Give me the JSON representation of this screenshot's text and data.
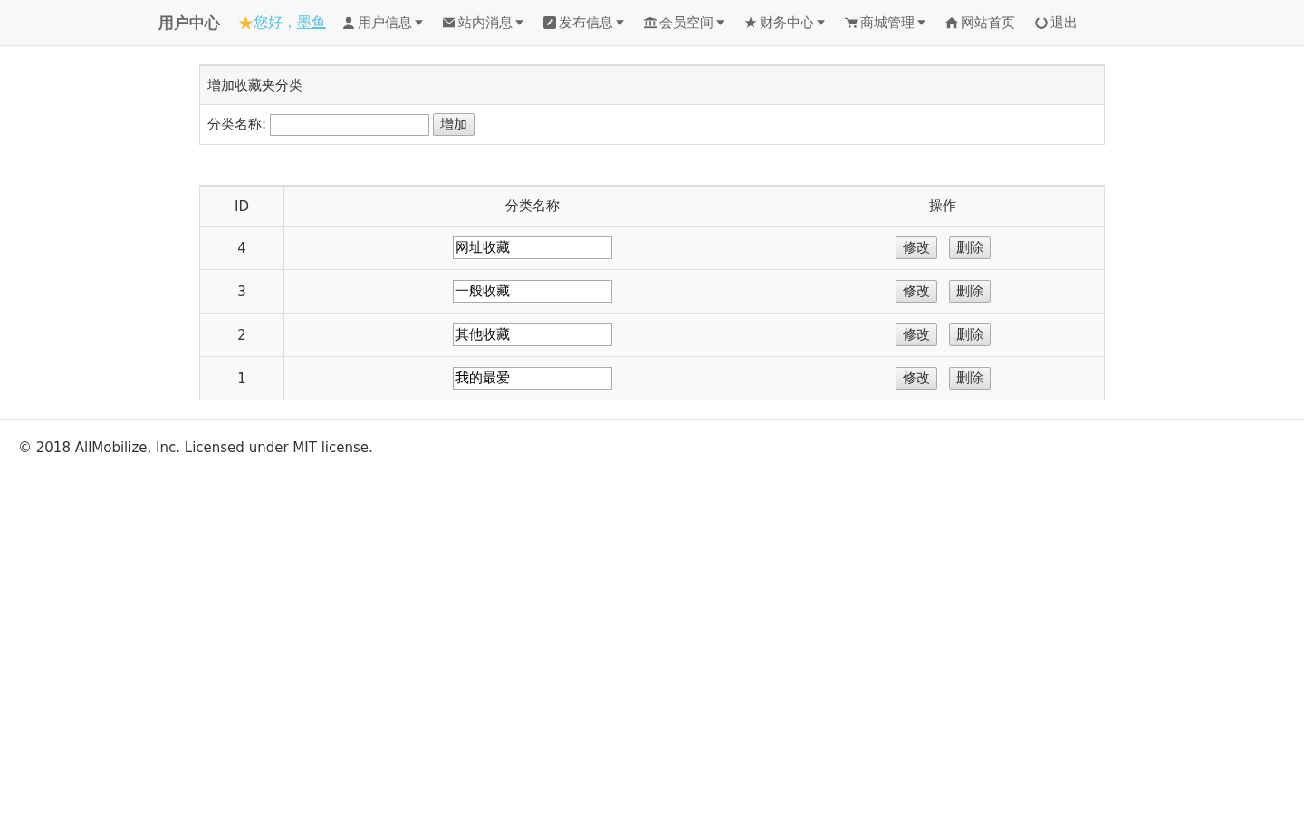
{
  "navbar": {
    "brand": "用户中心",
    "greeting": "您好，",
    "username": "墨鱼",
    "items": [
      {
        "label": "用户信息",
        "dropdown": true
      },
      {
        "label": "站内消息",
        "dropdown": true
      },
      {
        "label": "发布信息",
        "dropdown": true
      },
      {
        "label": "会员空间",
        "dropdown": true
      },
      {
        "label": "财务中心",
        "dropdown": true
      },
      {
        "label": "商城管理",
        "dropdown": true
      },
      {
        "label": "网站首页",
        "dropdown": false
      },
      {
        "label": "退出",
        "dropdown": false
      }
    ]
  },
  "add_panel": {
    "title": "增加收藏夹分类",
    "field_label": "分类名称:",
    "button": "增加"
  },
  "table": {
    "columns": [
      "ID",
      "分类名称",
      "操作"
    ],
    "rows": [
      {
        "id": "4",
        "name": "网址收藏",
        "actions": [
          "修改",
          "删除"
        ]
      },
      {
        "id": "3",
        "name": "一般收藏",
        "actions": [
          "修改",
          "删除"
        ]
      },
      {
        "id": "2",
        "name": "其他收藏",
        "actions": [
          "修改",
          "删除"
        ]
      },
      {
        "id": "1",
        "name": "我的最爱",
        "actions": [
          "修改",
          "删除"
        ]
      }
    ]
  },
  "footer": "© 2018 AllMobilize, Inc. Licensed under MIT license."
}
